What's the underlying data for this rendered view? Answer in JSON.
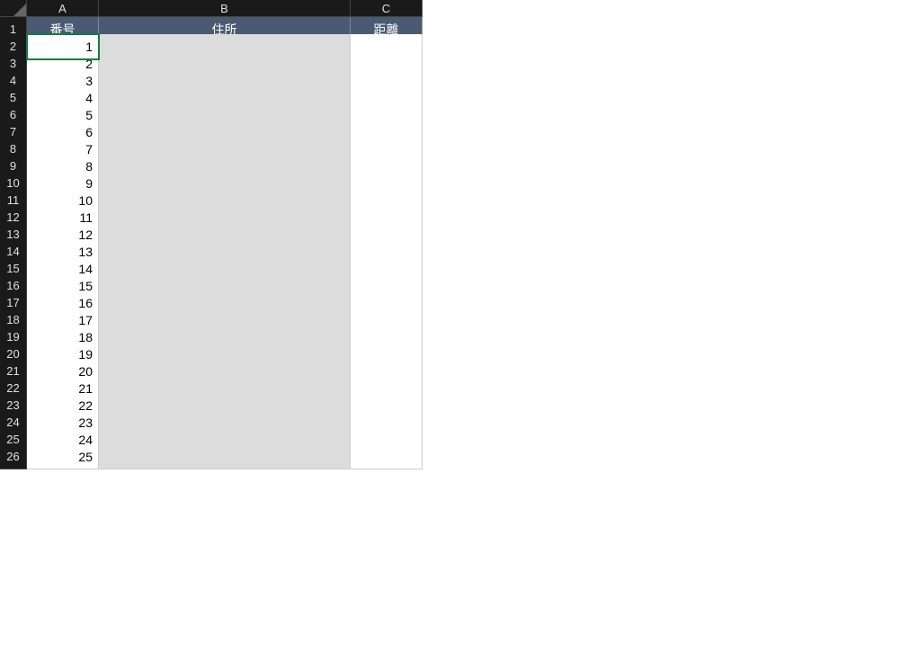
{
  "columns": [
    "A",
    "B",
    "C"
  ],
  "rowNumbers": [
    "1",
    "2",
    "3",
    "4",
    "5",
    "6",
    "7",
    "8",
    "9",
    "10",
    "11",
    "12",
    "13",
    "14",
    "15",
    "16",
    "17",
    "18",
    "19",
    "20",
    "21",
    "22",
    "23",
    "24",
    "25",
    "26"
  ],
  "headers": {
    "colA": "番号",
    "colB": "住所",
    "colC": "距離"
  },
  "dataRows": [
    {
      "num": "1",
      "addr": "",
      "dist": ""
    },
    {
      "num": "2",
      "addr": "",
      "dist": ""
    },
    {
      "num": "3",
      "addr": "",
      "dist": ""
    },
    {
      "num": "4",
      "addr": "",
      "dist": ""
    },
    {
      "num": "5",
      "addr": "",
      "dist": ""
    },
    {
      "num": "6",
      "addr": "",
      "dist": ""
    },
    {
      "num": "7",
      "addr": "",
      "dist": ""
    },
    {
      "num": "8",
      "addr": "",
      "dist": ""
    },
    {
      "num": "9",
      "addr": "",
      "dist": ""
    },
    {
      "num": "10",
      "addr": "",
      "dist": ""
    },
    {
      "num": "11",
      "addr": "",
      "dist": ""
    },
    {
      "num": "12",
      "addr": "",
      "dist": ""
    },
    {
      "num": "13",
      "addr": "",
      "dist": ""
    },
    {
      "num": "14",
      "addr": "",
      "dist": ""
    },
    {
      "num": "15",
      "addr": "",
      "dist": ""
    },
    {
      "num": "16",
      "addr": "",
      "dist": ""
    },
    {
      "num": "17",
      "addr": "",
      "dist": ""
    },
    {
      "num": "18",
      "addr": "",
      "dist": ""
    },
    {
      "num": "19",
      "addr": "",
      "dist": ""
    },
    {
      "num": "20",
      "addr": "",
      "dist": ""
    },
    {
      "num": "21",
      "addr": "",
      "dist": ""
    },
    {
      "num": "22",
      "addr": "",
      "dist": ""
    },
    {
      "num": "23",
      "addr": "",
      "dist": ""
    },
    {
      "num": "24",
      "addr": "",
      "dist": ""
    },
    {
      "num": "25",
      "addr": "",
      "dist": ""
    }
  ],
  "activeCell": "A2"
}
